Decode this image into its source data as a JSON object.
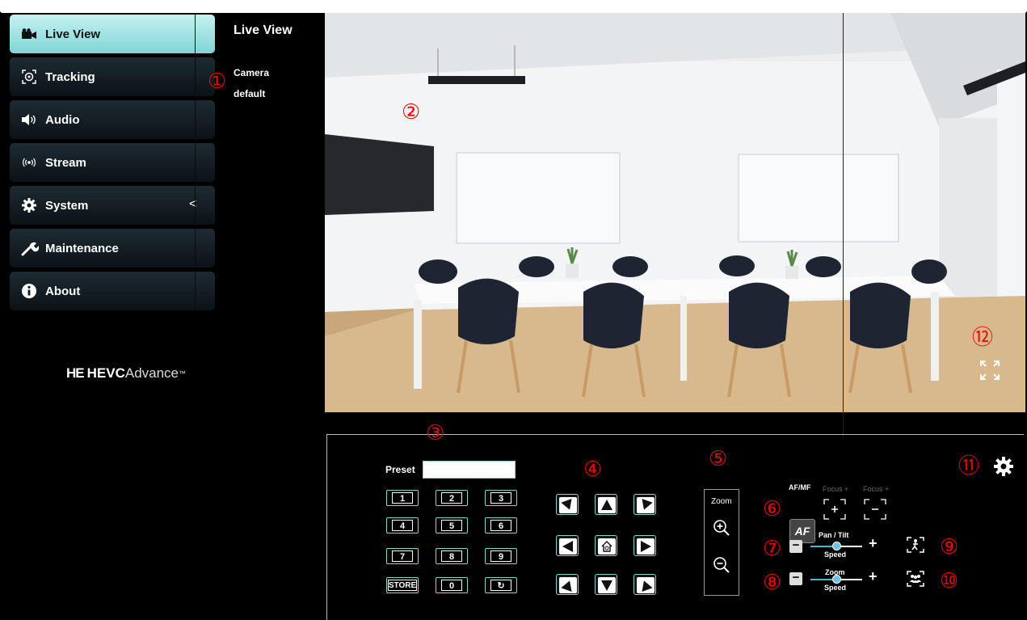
{
  "sidebar": {
    "items": [
      {
        "label": "Live View",
        "icon": "video-camera-icon",
        "active": true
      },
      {
        "label": "Tracking",
        "icon": "tracking-target-icon"
      },
      {
        "label": "Audio",
        "icon": "speaker-icon"
      },
      {
        "label": "Stream",
        "icon": "broadcast-icon"
      },
      {
        "label": "System",
        "icon": "gear-icon",
        "chevron": "<"
      },
      {
        "label": "Maintenance",
        "icon": "wrench-icon"
      },
      {
        "label": "About",
        "icon": "info-icon"
      }
    ],
    "brand": {
      "he": "HE",
      "hevc": "HEVC",
      "advance": "Advance",
      "tm": "™"
    }
  },
  "header": {
    "title": "Live View"
  },
  "camera": {
    "name": "Camera",
    "profile": "default"
  },
  "markers": [
    "①",
    "②",
    "③",
    "④",
    "⑤",
    "⑥",
    "⑦",
    "⑧",
    "⑨",
    "⑩",
    "⑪",
    "⑫"
  ],
  "preset": {
    "label": "Preset",
    "value": "",
    "keys": [
      "1",
      "2",
      "3",
      "4",
      "5",
      "6",
      "7",
      "8",
      "9",
      "STORE",
      "0",
      "↻"
    ]
  },
  "zoom": {
    "label": "Zoom"
  },
  "focus": {
    "afmf_label": "AF/MF",
    "af_button": "AF",
    "focus_plus_label": "Focus +",
    "focus_minus_label": "Focus +"
  },
  "pan_tilt_speed": {
    "top": "Pan / Tilt",
    "bottom": "Speed",
    "minus": "−",
    "plus": "+",
    "level": 0.5
  },
  "zoom_speed": {
    "top": "Zoom",
    "bottom": "Speed",
    "minus": "−",
    "plus": "+",
    "level": 0.5
  },
  "colors": {
    "accent": "#8fd0d0",
    "active_nav": "#a6e6e6",
    "marker": "#e00000"
  }
}
